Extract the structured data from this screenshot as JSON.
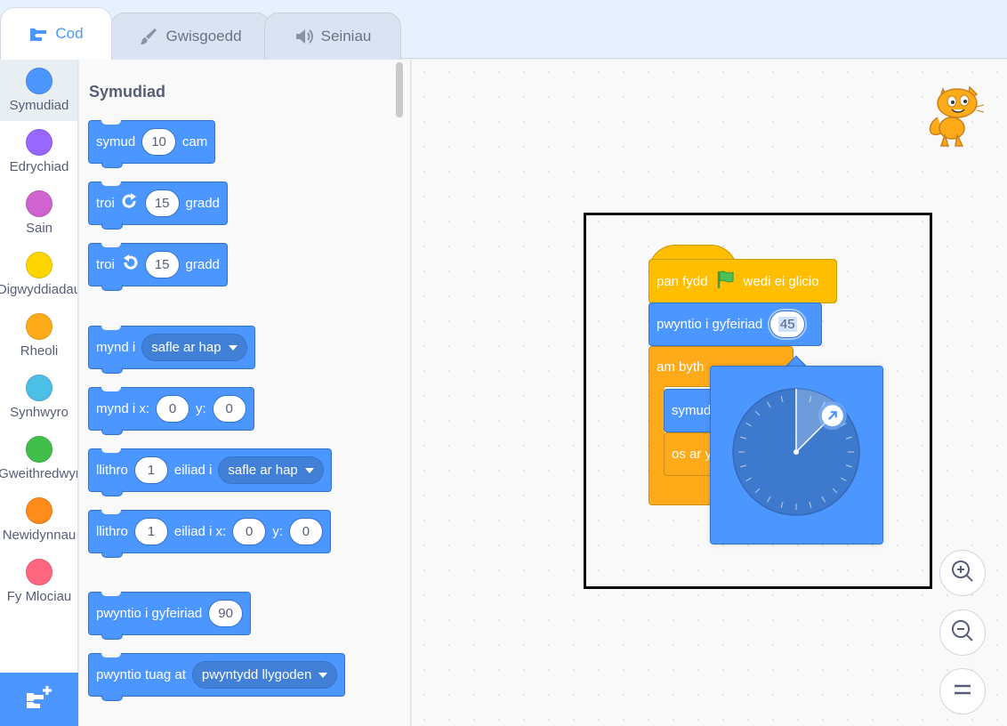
{
  "tabs": [
    {
      "label": "Cod",
      "icon": "code-icon",
      "active": true
    },
    {
      "label": "Gwisgoedd",
      "icon": "paintbrush-icon",
      "active": false
    },
    {
      "label": "Seiniau",
      "icon": "speaker-icon",
      "active": false
    }
  ],
  "categories": [
    {
      "label": "Symudiad",
      "color": "#4c97ff",
      "selected": true
    },
    {
      "label": "Edrychiad",
      "color": "#9966ff"
    },
    {
      "label": "Sain",
      "color": "#cf63cf"
    },
    {
      "label": "Digwyddiadau",
      "color": "#ffd500"
    },
    {
      "label": "Rheoli",
      "color": "#ffab19"
    },
    {
      "label": "Synhwyro",
      "color": "#4cbfe6"
    },
    {
      "label": "Gweithredwyr",
      "color": "#40bf4a"
    },
    {
      "label": "Newidynnau",
      "color": "#ff8c1a"
    },
    {
      "label": "Fy Mlociau",
      "color": "#ff6680"
    }
  ],
  "palette": {
    "title": "Symudiad",
    "blocks": {
      "move": {
        "pre": "symud",
        "value": "10",
        "post": "cam"
      },
      "turn_right": {
        "pre": "troi",
        "value": "15",
        "post": "gradd"
      },
      "turn_left": {
        "pre": "troi",
        "value": "15",
        "post": "gradd"
      },
      "goto": {
        "pre": "mynd i",
        "option": "safle ar hap"
      },
      "goto_xy": {
        "pre": "mynd i x:",
        "x": "0",
        "ylabel": "y:",
        "y": "0"
      },
      "glide_to": {
        "pre": "llithro",
        "value": "1",
        "mid": "eiliad i",
        "option": "safle ar hap"
      },
      "glide_xy": {
        "pre": "llithro",
        "value": "1",
        "mid": "eiliad i x:",
        "x": "0",
        "ylabel": "y:",
        "y": "0"
      },
      "point_dir": {
        "pre": "pwyntio i gyfeiriad",
        "value": "90"
      },
      "point_towards": {
        "pre": "pwyntio tuag at",
        "option": "pwyntydd llygoden"
      }
    }
  },
  "script": {
    "hat": {
      "pre": "pan fydd",
      "post": "wedi ei glicio"
    },
    "point": {
      "pre": "pwyntio i gyfeiriad",
      "value": "45"
    },
    "forever": {
      "label": "am byth"
    },
    "inner1": {
      "label": "symud"
    },
    "inner2": {
      "label": "os ar y"
    }
  },
  "dial": {
    "direction": 45
  },
  "colors": {
    "motion": "#4c97ff",
    "events": "#ffbf00",
    "control": "#ffab19",
    "accent": "#4c97ff"
  }
}
